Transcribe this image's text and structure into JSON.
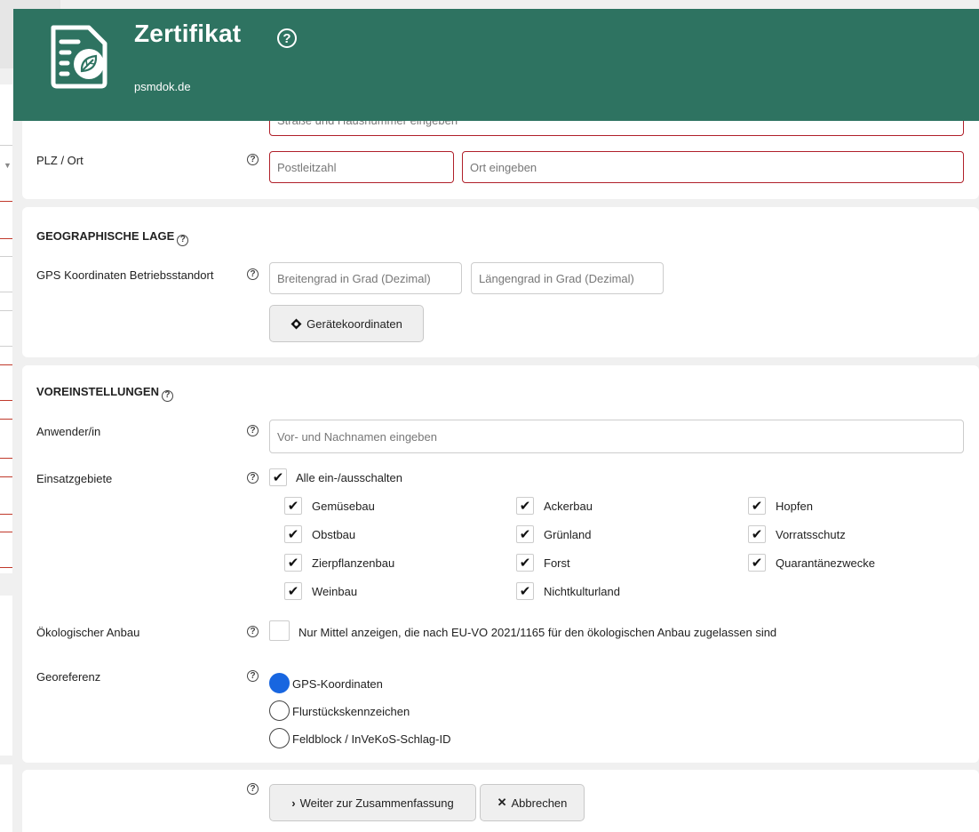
{
  "header": {
    "title": "Zertifikat",
    "subtitle": "psmdok.de",
    "help": "?"
  },
  "address": {
    "street_placeholder": "Straße und Hausnummer eingeben",
    "plz_ort_label": "PLZ / Ort",
    "plz_placeholder": "Postleitzahl",
    "ort_placeholder": "Ort eingeben"
  },
  "geo": {
    "section_title": "GEOGRAPHISCHE LAGE",
    "gps_label": "GPS Koordinaten Betriebsstandort",
    "lat_placeholder": "Breitengrad in Grad (Dezimal)",
    "lon_placeholder": "Längengrad in Grad (Dezimal)",
    "device_button": "Gerätekoordinaten"
  },
  "settings": {
    "section_title": "VOREINSTELLUNGEN",
    "user_label": "Anwender/in",
    "user_placeholder": "Vor- und Nachnamen eingeben",
    "areas_label": "Einsatzgebiete",
    "toggle_all": "Alle ein-/ausschalten",
    "areas": [
      {
        "label": "Gemüsebau",
        "checked": true
      },
      {
        "label": "Obstbau",
        "checked": true
      },
      {
        "label": "Zierpflanzenbau",
        "checked": true
      },
      {
        "label": "Weinbau",
        "checked": true
      },
      {
        "label": "Ackerbau",
        "checked": true
      },
      {
        "label": "Grünland",
        "checked": true
      },
      {
        "label": "Forst",
        "checked": true
      },
      {
        "label": "Nichtkulturland",
        "checked": true
      },
      {
        "label": "Hopfen",
        "checked": true
      },
      {
        "label": "Vorratsschutz",
        "checked": true
      },
      {
        "label": "Quarantänezwecke",
        "checked": true
      }
    ],
    "eco_label": "Ökologischer Anbau",
    "eco_text": "Nur Mittel anzeigen, die nach EU-VO 2021/1165 für den ökologischen Anbau zugelassen sind",
    "georef_label": "Georeferenz",
    "georef_options": [
      {
        "label": "GPS-Koordinaten",
        "selected": true
      },
      {
        "label": "Flurstückskennzeichen",
        "selected": false
      },
      {
        "label": "Feldblock / InVeKoS-Schlag-ID",
        "selected": false
      }
    ]
  },
  "actions": {
    "next_button": "Weiter zur Zusammenfassung",
    "cancel_button": "Abbrechen"
  },
  "colors": {
    "header": "#2e7361",
    "error_border": "#b0202a",
    "radio_selected": "#1866e0"
  }
}
